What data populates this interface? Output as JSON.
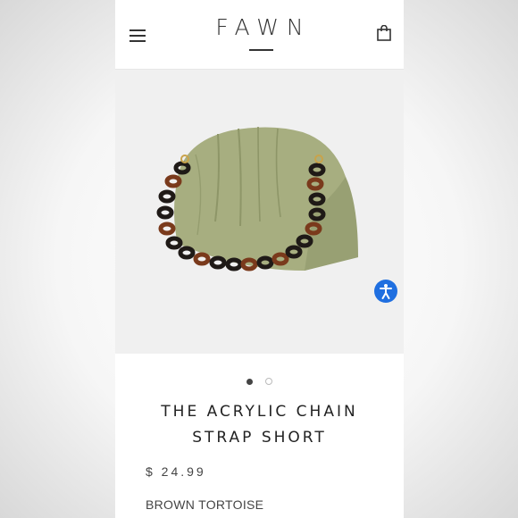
{
  "header": {
    "logo": "FAWN",
    "menu_icon": "hamburger-menu-icon",
    "cart_icon": "shopping-bag-icon"
  },
  "product": {
    "title": "THE ACRYLIC CHAIN STRAP SHORT",
    "price": "$ 24.99",
    "variant": "BROWN TORTOISE"
  },
  "gallery": {
    "image_count": 2,
    "active_index": 0
  },
  "accessibility": {
    "icon": "accessibility-icon",
    "color": "#1f6fe0"
  },
  "colors": {
    "bag": "#a7ae80",
    "chain_dark": "#1f1a17",
    "chain_tortoise": "#7a3a1c"
  }
}
